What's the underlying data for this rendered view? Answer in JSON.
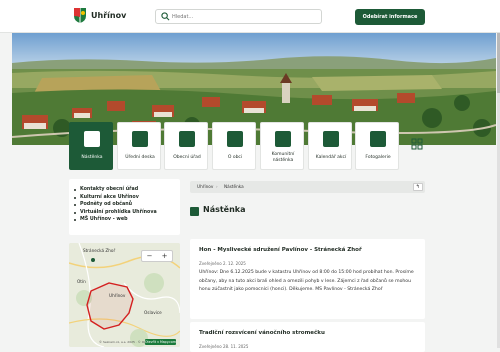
{
  "header": {
    "brand": "Uhřínov",
    "search_placeholder": "Hledat...",
    "subscribe_label": "Odebírat informace"
  },
  "tiles": [
    {
      "label": "Nástěnka",
      "icon": "bulletin-icon",
      "active": true
    },
    {
      "label": "Úřední deska",
      "icon": "board-icon",
      "active": false
    },
    {
      "label": "Obecní úřad",
      "icon": "town-hall-icon",
      "active": false
    },
    {
      "label": "O obci",
      "icon": "village-icon",
      "active": false
    },
    {
      "label": "Komunitní\nnástěnka",
      "icon": "community-icon",
      "active": false
    },
    {
      "label": "Kalendář akcí",
      "icon": "calendar-icon",
      "active": false
    },
    {
      "label": "Fotogalerie",
      "icon": "gallery-icon",
      "active": false
    }
  ],
  "sidebar": {
    "links": [
      "Kontakty obecní úřad",
      "Kulturní akce Uhřínov",
      "Podněty od občanů",
      "Virtuální prohlídka Uhřínova",
      "MŠ Uhřínov - web"
    ]
  },
  "map": {
    "zoom_in": "+",
    "zoom_out": "−",
    "places": [
      "Stránecká Zhoř",
      "Otín",
      "Uhřínov",
      "Oslavice"
    ],
    "attribution": "© Seznam.cz, a.s. 2025 · © OpenStreetMap",
    "mapy_button": "Otevřít v Mapy.com"
  },
  "breadcrumb": {
    "home": "Uhřínov",
    "separator": "›",
    "current": "Nástěnka",
    "back": "↰"
  },
  "page": {
    "title": "Nástěnka"
  },
  "posts": [
    {
      "title": "Hon - Myslivecké sdružení Pavlínov - Stránecká Zhoř",
      "date": "Zveřejněno 2. 12. 2025",
      "text": "Uhřínov: Dne 6.12.2025 bude v katastru Uhřínov od 8:00 do 15:00 hod probíhat hon. Prosíme občany, aby na tuto akci brali ohled a omezili pohyb v lese. Zájemci z řad občanů se mohou honu zúčastnit jako pomocníci (honci). Děkujeme. MS Pavlínov - Stránecká Zhoř"
    },
    {
      "title": "Tradiční rozsvícení vánočního stromečku",
      "date": "Zveřejněno 28. 11. 2025",
      "text": ""
    }
  ],
  "colors": {
    "brand_green": "#1d5a37",
    "background": "#f3f4f3"
  }
}
